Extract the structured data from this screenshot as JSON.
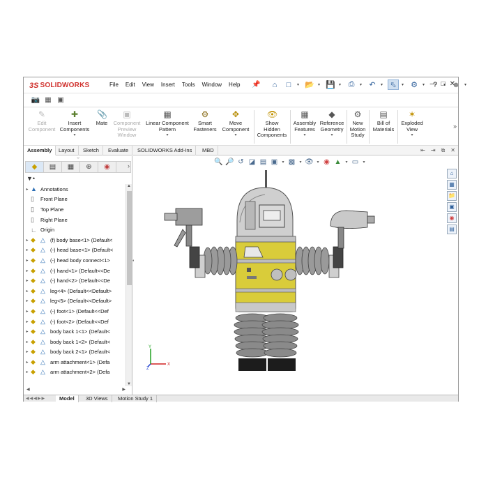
{
  "app": {
    "logo_ds": "3S",
    "logo_name": "SOLIDWORKS"
  },
  "menu": [
    "File",
    "Edit",
    "View",
    "Insert",
    "Tools",
    "Window",
    "Help"
  ],
  "quick_access": [
    "home-icon",
    "new-document-icon",
    "open-icon",
    "save-icon",
    "print-icon",
    "undo-icon",
    "select-icon",
    "rebuild-icon",
    "help-icon",
    "user-icon"
  ],
  "quick_access_glyphs": {
    "help": "?"
  },
  "command_manager": [
    {
      "label": "Edit Component",
      "disabled": true
    },
    {
      "label": "Insert Components",
      "disabled": false
    },
    {
      "label": "Mate",
      "disabled": false
    },
    {
      "label": "Component Preview Window",
      "disabled": true
    },
    {
      "label": "Linear Component Pattern",
      "disabled": false
    },
    {
      "label": "Smart Fasteners",
      "disabled": false
    },
    {
      "label": "Move Component",
      "disabled": false
    },
    {
      "label": "Show Hidden Components",
      "disabled": false
    },
    {
      "label": "Assembly Features",
      "disabled": false
    },
    {
      "label": "Reference Geometry",
      "disabled": false
    },
    {
      "label": "New Motion Study",
      "disabled": false
    },
    {
      "label": "Bill of Materials",
      "disabled": false
    },
    {
      "label": "Exploded View",
      "disabled": false
    }
  ],
  "cmd_labels": {
    "edit": [
      "Edit",
      "Component"
    ],
    "insert": [
      "Insert",
      "Components"
    ],
    "mate": [
      "Mate"
    ],
    "preview": [
      "Component",
      "Preview",
      "Window"
    ],
    "linear": [
      "Linear Component",
      "Pattern"
    ],
    "smart": [
      "Smart",
      "Fasteners"
    ],
    "move": [
      "Move",
      "Component"
    ],
    "show": [
      "Show",
      "Hidden",
      "Components"
    ],
    "afeat": [
      "Assembly",
      "Features"
    ],
    "refgeo": [
      "Reference",
      "Geometry"
    ],
    "motion": [
      "New",
      "Motion",
      "Study"
    ],
    "bom": [
      "Bill of",
      "Materials"
    ],
    "explode": [
      "Exploded",
      "View"
    ]
  },
  "ribbon_tabs": [
    "Assembly",
    "Layout",
    "Sketch",
    "Evaluate",
    "SOLIDWORKS Add-Ins",
    "MBD"
  ],
  "active_ribbon_tab": "Assembly",
  "feature_tree": {
    "static": [
      "Annotations",
      "Front Plane",
      "Top Plane",
      "Right Plane",
      "Origin"
    ],
    "components": [
      "(f) body base<1> (Default<",
      "(-) head base<1> (Default<",
      "(-) head body connect<1>",
      "(-) hand<1> (Default<<De",
      "(-) hand<2> (Default<<De",
      "leg<4> (Default<<Default>",
      "leg<5> (Default<<Default>",
      "(-) foot<1> (Default<<Def",
      "(-) foot<2> (Default<<Def",
      "body back 1<1> (Default<",
      "body back 1<2> (Default<",
      "body back 2<1> (Default<",
      "arm attachment<1> (Defa",
      "arm attachment<2> (Defa"
    ]
  },
  "bottom_tabs": [
    "Model",
    "3D Views",
    "Motion Study 1"
  ],
  "active_bottom_tab": "Model",
  "triad": {
    "x": "X",
    "y": "Y",
    "z": "Z"
  },
  "colors": {
    "brand": "#d0312d",
    "accent_yellow": "#d9cc3a",
    "body_gray": "#b9b9b9"
  }
}
